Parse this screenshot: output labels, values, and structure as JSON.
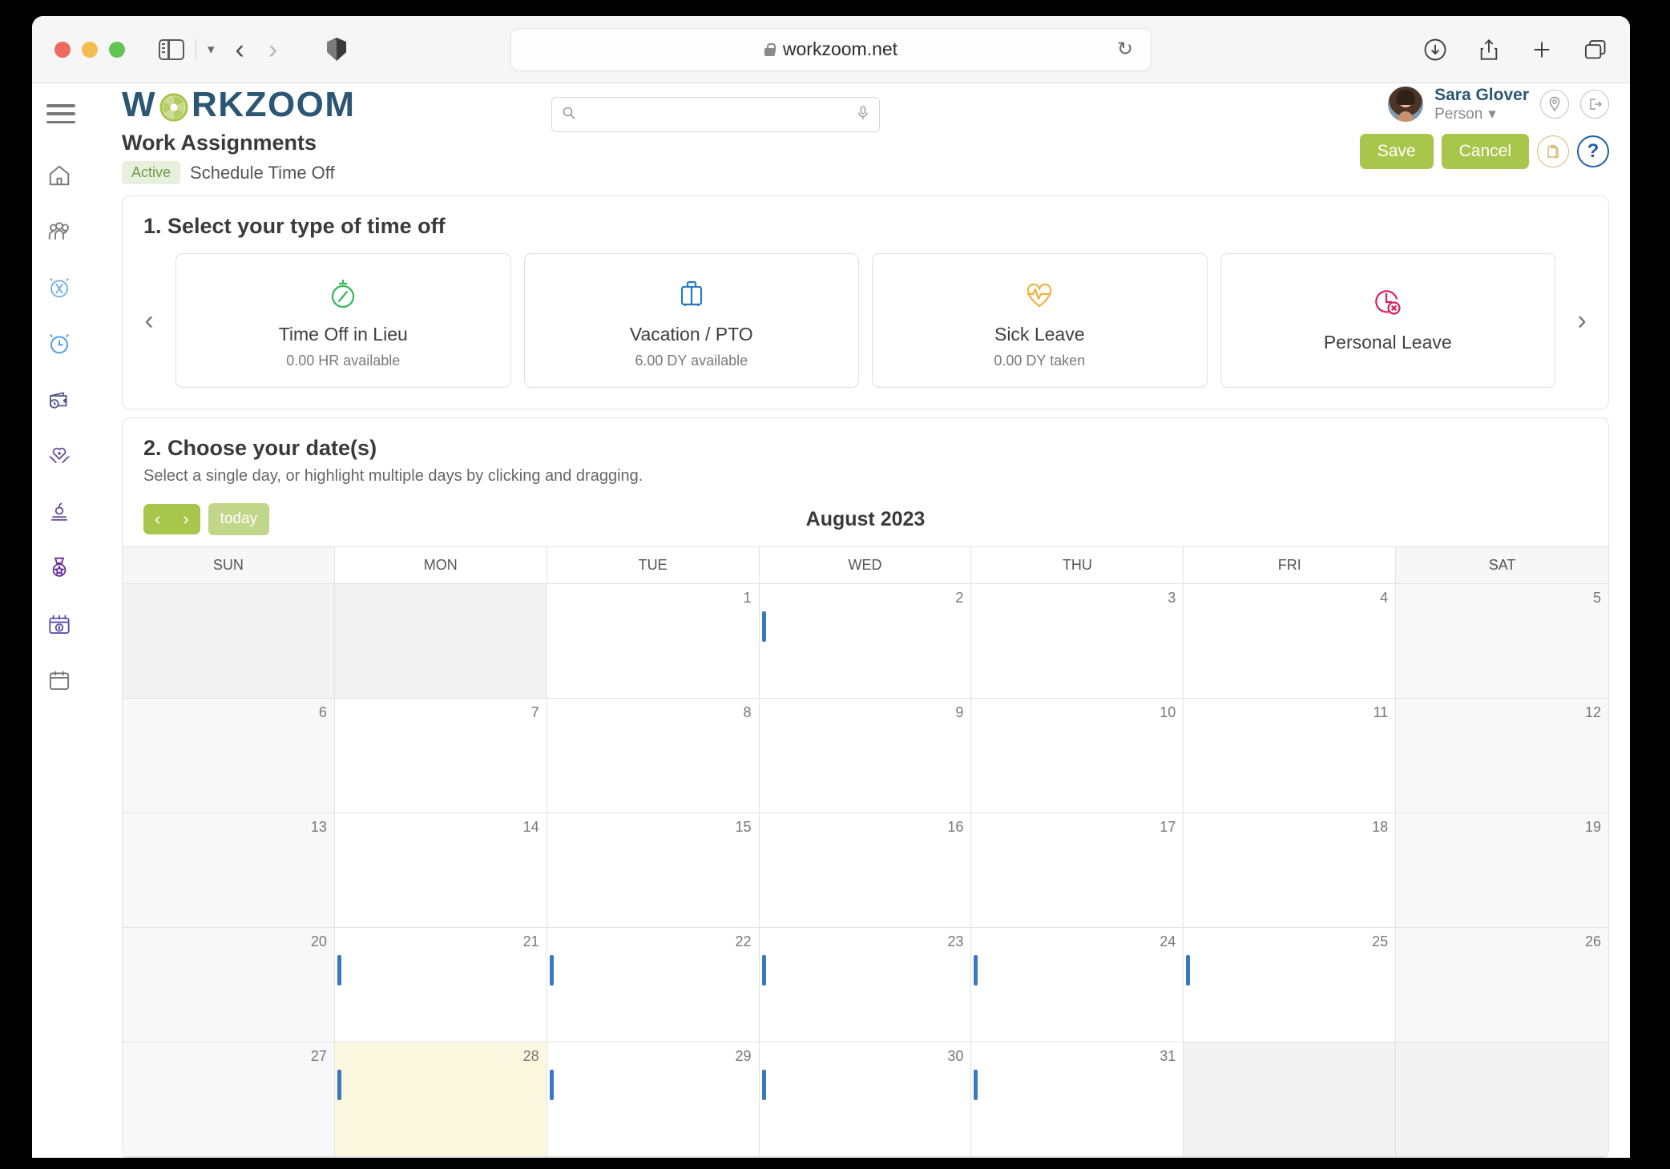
{
  "browser": {
    "url": "workzoom.net",
    "lock_icon": "lock-icon",
    "reload_icon": "reload-icon",
    "back_icon": "back-chevron-icon",
    "forward_icon": "forward-chevron-icon",
    "sidebar_icon": "sidebar-toggle-icon",
    "tab_overview_chevron": "chevron-down-icon",
    "shield_icon": "privacy-shield-icon",
    "download_icon": "download-icon",
    "share_icon": "share-icon",
    "new_tab_icon": "plus-icon",
    "tabs_icon": "tab-overview-icon"
  },
  "rail": {
    "items": [
      {
        "icon": "home-icon",
        "color": "#7a7a7a"
      },
      {
        "icon": "people-icon",
        "color": "#7a7a7a"
      },
      {
        "icon": "alarm-clock-off-icon",
        "color": "#79b6e8"
      },
      {
        "icon": "alarm-clock-icon",
        "color": "#4f9fe0"
      },
      {
        "icon": "wallet-clock-icon",
        "color": "#5a5a8a"
      },
      {
        "icon": "heart-in-hands-icon",
        "color": "#6b4f9e"
      },
      {
        "icon": "apple-books-icon",
        "color": "#6b4f9e"
      },
      {
        "icon": "medal-icon",
        "color": "#6b2f9e"
      },
      {
        "icon": "calendar-dollar-icon",
        "color": "#5a4fa8"
      },
      {
        "icon": "calendar-icon",
        "color": "#7a7a7a"
      }
    ]
  },
  "header": {
    "menu_icon": "hamburger-menu-icon",
    "logo_text_before": "W",
    "logo_aperture": "aperture-icon",
    "logo_text_after": "RKZOOM",
    "logo_color": "#2b5674",
    "logo_accent_color": "#a8c54c"
  },
  "search": {
    "value": "",
    "placeholder": "",
    "search_icon": "search-icon",
    "mic_icon": "microphone-icon"
  },
  "user": {
    "name": "Sara Glover",
    "role": "Person",
    "role_chevron": "chevron-down-icon",
    "avatar": "avatar",
    "location_icon": "location-pin-icon",
    "logout_icon": "logout-icon"
  },
  "page": {
    "title": "Work Assignments",
    "status_badge": "Active",
    "subtitle": "Schedule Time Off",
    "badge_text_color": "#6f9a4a",
    "badge_bg_color": "#e6f0dc"
  },
  "actions": {
    "save_label": "Save",
    "cancel_label": "Cancel",
    "notes_icon": "notes-icon",
    "help_icon": "help-icon",
    "button_color": "#a8c54c"
  },
  "step1": {
    "heading": "1. Select your type of time off",
    "prev_icon": "carousel-prev-icon",
    "next_icon": "carousel-next-icon",
    "cards": [
      {
        "label": "Time Off in Lieu",
        "meta": "0.00 HR available",
        "icon": "stopwatch-off-icon",
        "color": "#35b55a"
      },
      {
        "label": "Vacation / PTO",
        "meta": "6.00 DY available",
        "icon": "suitcase-icon",
        "color": "#2a79b8"
      },
      {
        "label": "Sick Leave",
        "meta": "0.00 DY taken",
        "icon": "heart-pulse-icon",
        "color": "#f2b23e"
      },
      {
        "label": "Personal Leave",
        "meta": "",
        "icon": "clock-x-icon",
        "color": "#d81e5b"
      }
    ]
  },
  "step2": {
    "heading": "2. Choose your date(s)",
    "instructions": "Select a single day, or highlight multiple days by clicking and dragging.",
    "prev_label": "‹",
    "next_label": "›",
    "today_label": "today",
    "month_title": "August 2023",
    "weekday_headers": [
      "SUN",
      "MON",
      "TUE",
      "WED",
      "THU",
      "FRI",
      "SAT"
    ],
    "event_color": "#3b78c3",
    "today_bg_color": "#fcf8e0",
    "cells": [
      {
        "num": "",
        "out": true,
        "weekend": false,
        "event": false,
        "today": false
      },
      {
        "num": "",
        "out": true,
        "weekend": false,
        "event": false,
        "today": false
      },
      {
        "num": "1",
        "out": false,
        "weekend": false,
        "event": false,
        "today": false
      },
      {
        "num": "2",
        "out": false,
        "weekend": false,
        "event": true,
        "today": false
      },
      {
        "num": "3",
        "out": false,
        "weekend": false,
        "event": false,
        "today": false
      },
      {
        "num": "4",
        "out": false,
        "weekend": false,
        "event": false,
        "today": false
      },
      {
        "num": "5",
        "out": false,
        "weekend": true,
        "event": false,
        "today": false
      },
      {
        "num": "6",
        "out": false,
        "weekend": true,
        "event": false,
        "today": false
      },
      {
        "num": "7",
        "out": false,
        "weekend": false,
        "event": false,
        "today": false
      },
      {
        "num": "8",
        "out": false,
        "weekend": false,
        "event": false,
        "today": false
      },
      {
        "num": "9",
        "out": false,
        "weekend": false,
        "event": false,
        "today": false
      },
      {
        "num": "10",
        "out": false,
        "weekend": false,
        "event": false,
        "today": false
      },
      {
        "num": "11",
        "out": false,
        "weekend": false,
        "event": false,
        "today": false
      },
      {
        "num": "12",
        "out": false,
        "weekend": true,
        "event": false,
        "today": false
      },
      {
        "num": "13",
        "out": false,
        "weekend": true,
        "event": false,
        "today": false
      },
      {
        "num": "14",
        "out": false,
        "weekend": false,
        "event": false,
        "today": false
      },
      {
        "num": "15",
        "out": false,
        "weekend": false,
        "event": false,
        "today": false
      },
      {
        "num": "16",
        "out": false,
        "weekend": false,
        "event": false,
        "today": false
      },
      {
        "num": "17",
        "out": false,
        "weekend": false,
        "event": false,
        "today": false
      },
      {
        "num": "18",
        "out": false,
        "weekend": false,
        "event": false,
        "today": false
      },
      {
        "num": "19",
        "out": false,
        "weekend": true,
        "event": false,
        "today": false
      },
      {
        "num": "20",
        "out": false,
        "weekend": true,
        "event": false,
        "today": false
      },
      {
        "num": "21",
        "out": false,
        "weekend": false,
        "event": true,
        "today": false
      },
      {
        "num": "22",
        "out": false,
        "weekend": false,
        "event": true,
        "today": false
      },
      {
        "num": "23",
        "out": false,
        "weekend": false,
        "event": true,
        "today": false
      },
      {
        "num": "24",
        "out": false,
        "weekend": false,
        "event": true,
        "today": false
      },
      {
        "num": "25",
        "out": false,
        "weekend": false,
        "event": true,
        "today": false
      },
      {
        "num": "26",
        "out": false,
        "weekend": true,
        "event": false,
        "today": false
      },
      {
        "num": "27",
        "out": false,
        "weekend": true,
        "event": false,
        "today": false
      },
      {
        "num": "28",
        "out": false,
        "weekend": false,
        "event": true,
        "today": true
      },
      {
        "num": "29",
        "out": false,
        "weekend": false,
        "event": true,
        "today": false
      },
      {
        "num": "30",
        "out": false,
        "weekend": false,
        "event": true,
        "today": false
      },
      {
        "num": "31",
        "out": false,
        "weekend": false,
        "event": true,
        "today": false
      },
      {
        "num": "",
        "out": true,
        "weekend": false,
        "event": false,
        "today": false
      },
      {
        "num": "",
        "out": true,
        "weekend": true,
        "event": false,
        "today": false
      }
    ]
  }
}
